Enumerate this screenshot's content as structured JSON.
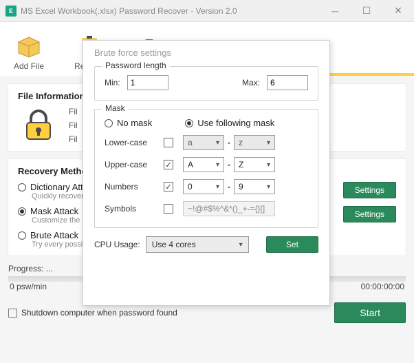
{
  "window": {
    "title": "MS Excel Workbook(.xlsx) Password Recover - Version 2.0"
  },
  "toolbar": {
    "addFile": "Add File",
    "remove": "Remove"
  },
  "fileInfo": {
    "title": "File Information:",
    "labels": [
      "Fil",
      "Fil",
      "Fil"
    ]
  },
  "recovery": {
    "title": "Recovery Method",
    "settingsLabel": "Settings",
    "methods": [
      {
        "label": "Dictionary Atta",
        "desc": "Quickly recover",
        "checked": false
      },
      {
        "label": "Mask Attack",
        "desc": "Customize the",
        "checked": true
      },
      {
        "label": "Brute Attack",
        "desc": "Try every possib",
        "checked": false
      }
    ]
  },
  "progress": {
    "label": "Progress:",
    "value": "...",
    "speed": "0 psw/min",
    "time": "00:00:00:00"
  },
  "footer": {
    "shutdown": "Shutdown computer when password found",
    "start": "Start"
  },
  "dialog": {
    "title": "Brute force settings",
    "pwLength": {
      "legend": "Password length",
      "minLabel": "Min:",
      "min": "1",
      "maxLabel": "Max:",
      "max": "6"
    },
    "mask": {
      "legend": "Mask",
      "noMask": "No mask",
      "useMask": "Use following mask",
      "rows": {
        "lower": {
          "label": "Lower-case",
          "checked": false,
          "from": "a",
          "to": "z"
        },
        "upper": {
          "label": "Upper-case",
          "checked": true,
          "from": "A",
          "to": "Z"
        },
        "numbers": {
          "label": "Numbers",
          "checked": true,
          "from": "0",
          "to": "9"
        },
        "symbols": {
          "label": "Symbols",
          "checked": false,
          "value": "~!@#$%^&*()_+-={}[]"
        }
      }
    },
    "cpu": {
      "label": "CPU Usage:",
      "value": "Use 4 cores"
    },
    "setLabel": "Set"
  }
}
